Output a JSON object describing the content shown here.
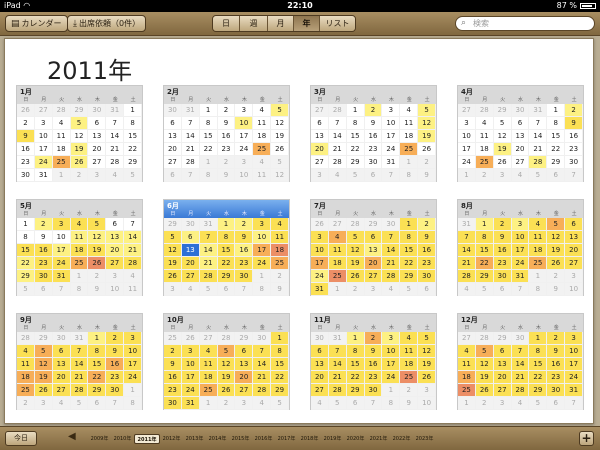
{
  "statusbar": {
    "device": "iPad",
    "wifi_icon": "wifi-icon",
    "time": "22:10",
    "battery": "87 %",
    "battery_level": 0.87
  },
  "toolbar": {
    "calendar_label": "カレンダー",
    "attend_label": "出席依頼（0件）",
    "views": [
      {
        "label": "日",
        "active": false
      },
      {
        "label": "週",
        "active": false
      },
      {
        "label": "月",
        "active": false
      },
      {
        "label": "年",
        "active": true
      },
      {
        "label": "リスト",
        "active": false
      }
    ],
    "search_placeholder": "検索"
  },
  "year_title": "2011年",
  "weekdays": [
    "日",
    "月",
    "火",
    "水",
    "木",
    "金",
    "土"
  ],
  "months": [
    {
      "title": "1月",
      "start": 26,
      "prev_len": 31,
      "len": 31,
      "levels": {
        "5": 1,
        "9": 2,
        "19": 1,
        "24": 1,
        "25": 3,
        "26": 1
      }
    },
    {
      "title": "2月",
      "start": 30,
      "prev_len": 31,
      "len": 28,
      "levels": {
        "5": 1,
        "10": 1,
        "25": 3
      }
    },
    {
      "title": "3月",
      "start": 27,
      "prev_len": 28,
      "len": 31,
      "levels": {
        "2": 1,
        "5": 1,
        "12": 1,
        "19": 1,
        "20": 1,
        "25": 3
      }
    },
    {
      "title": "4月",
      "start": 27,
      "prev_len": 31,
      "len": 30,
      "levels": {
        "2": 1,
        "9": 2,
        "25": 3,
        "19": 1,
        "28": 1
      }
    },
    {
      "title": "5月",
      "start": 1,
      "prev_len": 30,
      "len": 31,
      "levels": {
        "2": 1,
        "3": 2,
        "4": 2,
        "5": 2,
        "11": 1,
        "12": 1,
        "13": 1,
        "14": 1,
        "15": 2,
        "16": 2,
        "17": 1,
        "18": 2,
        "19": 2,
        "20": 1,
        "21": 1,
        "22": 1,
        "23": 2,
        "24": 2,
        "25": 3,
        "26": 4,
        "27": 2,
        "28": 2,
        "29": 1,
        "30": 2,
        "31": 2
      }
    },
    {
      "title": "6月",
      "start": 29,
      "prev_len": 31,
      "len": 30,
      "current": true,
      "today": 13,
      "levels": {
        "1": 1,
        "2": 1,
        "3": 2,
        "4": 2,
        "5": 2,
        "6": 1,
        "7": 2,
        "8": 2,
        "9": 2,
        "10": 1,
        "11": 2,
        "12": 2,
        "14": 1,
        "15": 2,
        "16": 1,
        "17": 3,
        "18": 4,
        "19": 2,
        "20": 2,
        "21": 1,
        "22": 2,
        "23": 2,
        "24": 2,
        "25": 3,
        "26": 2,
        "27": 2,
        "28": 2,
        "29": 2,
        "30": 2
      }
    },
    {
      "title": "7月",
      "start": 26,
      "prev_len": 30,
      "len": 31,
      "levels": {
        "1": 2,
        "2": 1,
        "3": 2,
        "4": 3,
        "5": 2,
        "6": 2,
        "7": 2,
        "8": 2,
        "9": 2,
        "10": 2,
        "11": 2,
        "12": 2,
        "13": 1,
        "14": 2,
        "15": 2,
        "16": 2,
        "17": 3,
        "18": 2,
        "19": 2,
        "20": 3,
        "21": 2,
        "22": 2,
        "23": 2,
        "24": 1,
        "25": 4,
        "26": 2,
        "27": 2,
        "28": 2,
        "29": 2,
        "30": 2,
        "31": 2
      }
    },
    {
      "title": "8月",
      "start": 31,
      "prev_len": 31,
      "len": 31,
      "levels": {
        "1": 1,
        "2": 2,
        "3": 1,
        "4": 2,
        "5": 3,
        "6": 2,
        "7": 2,
        "8": 2,
        "9": 2,
        "10": 2,
        "11": 2,
        "12": 2,
        "13": 2,
        "14": 2,
        "15": 2,
        "16": 2,
        "17": 2,
        "18": 2,
        "19": 2,
        "20": 2,
        "21": 2,
        "22": 3,
        "23": 2,
        "24": 2,
        "25": 3,
        "26": 2,
        "27": 2,
        "28": 2,
        "29": 2,
        "30": 2,
        "31": 2
      }
    },
    {
      "title": "9月",
      "start": 28,
      "prev_len": 31,
      "len": 30,
      "levels": {
        "1": 1,
        "2": 2,
        "3": 2,
        "4": 2,
        "5": 3,
        "6": 2,
        "7": 2,
        "8": 2,
        "9": 2,
        "10": 2,
        "11": 2,
        "12": 3,
        "13": 2,
        "14": 2,
        "15": 2,
        "16": 3,
        "17": 2,
        "18": 3,
        "19": 3,
        "20": 2,
        "21": 2,
        "22": 3,
        "23": 2,
        "24": 2,
        "25": 3,
        "26": 2,
        "27": 2,
        "28": 2,
        "29": 2,
        "30": 2
      }
    },
    {
      "title": "10月",
      "start": 25,
      "prev_len": 30,
      "len": 31,
      "levels": {
        "1": 2,
        "2": 2,
        "3": 2,
        "4": 2,
        "5": 3,
        "6": 2,
        "7": 2,
        "8": 2,
        "9": 2,
        "10": 2,
        "11": 2,
        "12": 2,
        "13": 2,
        "14": 2,
        "15": 2,
        "16": 2,
        "17": 2,
        "18": 2,
        "19": 2,
        "20": 3,
        "21": 2,
        "22": 2,
        "23": 2,
        "24": 2,
        "25": 3,
        "26": 2,
        "27": 2,
        "28": 2,
        "29": 2,
        "30": 2,
        "31": 2
      }
    },
    {
      "title": "11月",
      "start": 30,
      "prev_len": 31,
      "len": 30,
      "levels": {
        "1": 1,
        "2": 3,
        "3": 1,
        "4": 2,
        "5": 2,
        "6": 2,
        "7": 2,
        "8": 2,
        "9": 2,
        "10": 2,
        "11": 2,
        "12": 2,
        "13": 2,
        "14": 2,
        "15": 2,
        "16": 2,
        "17": 2,
        "18": 2,
        "19": 2,
        "20": 2,
        "21": 2,
        "22": 2,
        "23": 2,
        "24": 2,
        "25": 4,
        "26": 2,
        "27": 2,
        "28": 2,
        "29": 2,
        "30": 2
      }
    },
    {
      "title": "12月",
      "start": 27,
      "prev_len": 30,
      "len": 31,
      "levels": {
        "1": 2,
        "2": 2,
        "3": 2,
        "4": 2,
        "5": 3,
        "6": 2,
        "7": 2,
        "8": 2,
        "9": 2,
        "10": 2,
        "11": 2,
        "12": 2,
        "13": 2,
        "14": 2,
        "15": 2,
        "16": 2,
        "17": 2,
        "18": 3,
        "19": 2,
        "20": 2,
        "21": 2,
        "22": 2,
        "23": 2,
        "24": 2,
        "25": 4,
        "26": 2,
        "27": 2,
        "28": 2,
        "29": 2,
        "30": 2,
        "31": 2
      }
    }
  ],
  "bottombar": {
    "today_label": "今日",
    "years": [
      "2009年",
      "2010年",
      "2011年",
      "2012年",
      "2013年",
      "2014年",
      "2015年",
      "2016年",
      "2017年",
      "2018年",
      "2019年",
      "2020年",
      "2021年",
      "2022年",
      "2023年"
    ],
    "active_year": "2011年"
  }
}
